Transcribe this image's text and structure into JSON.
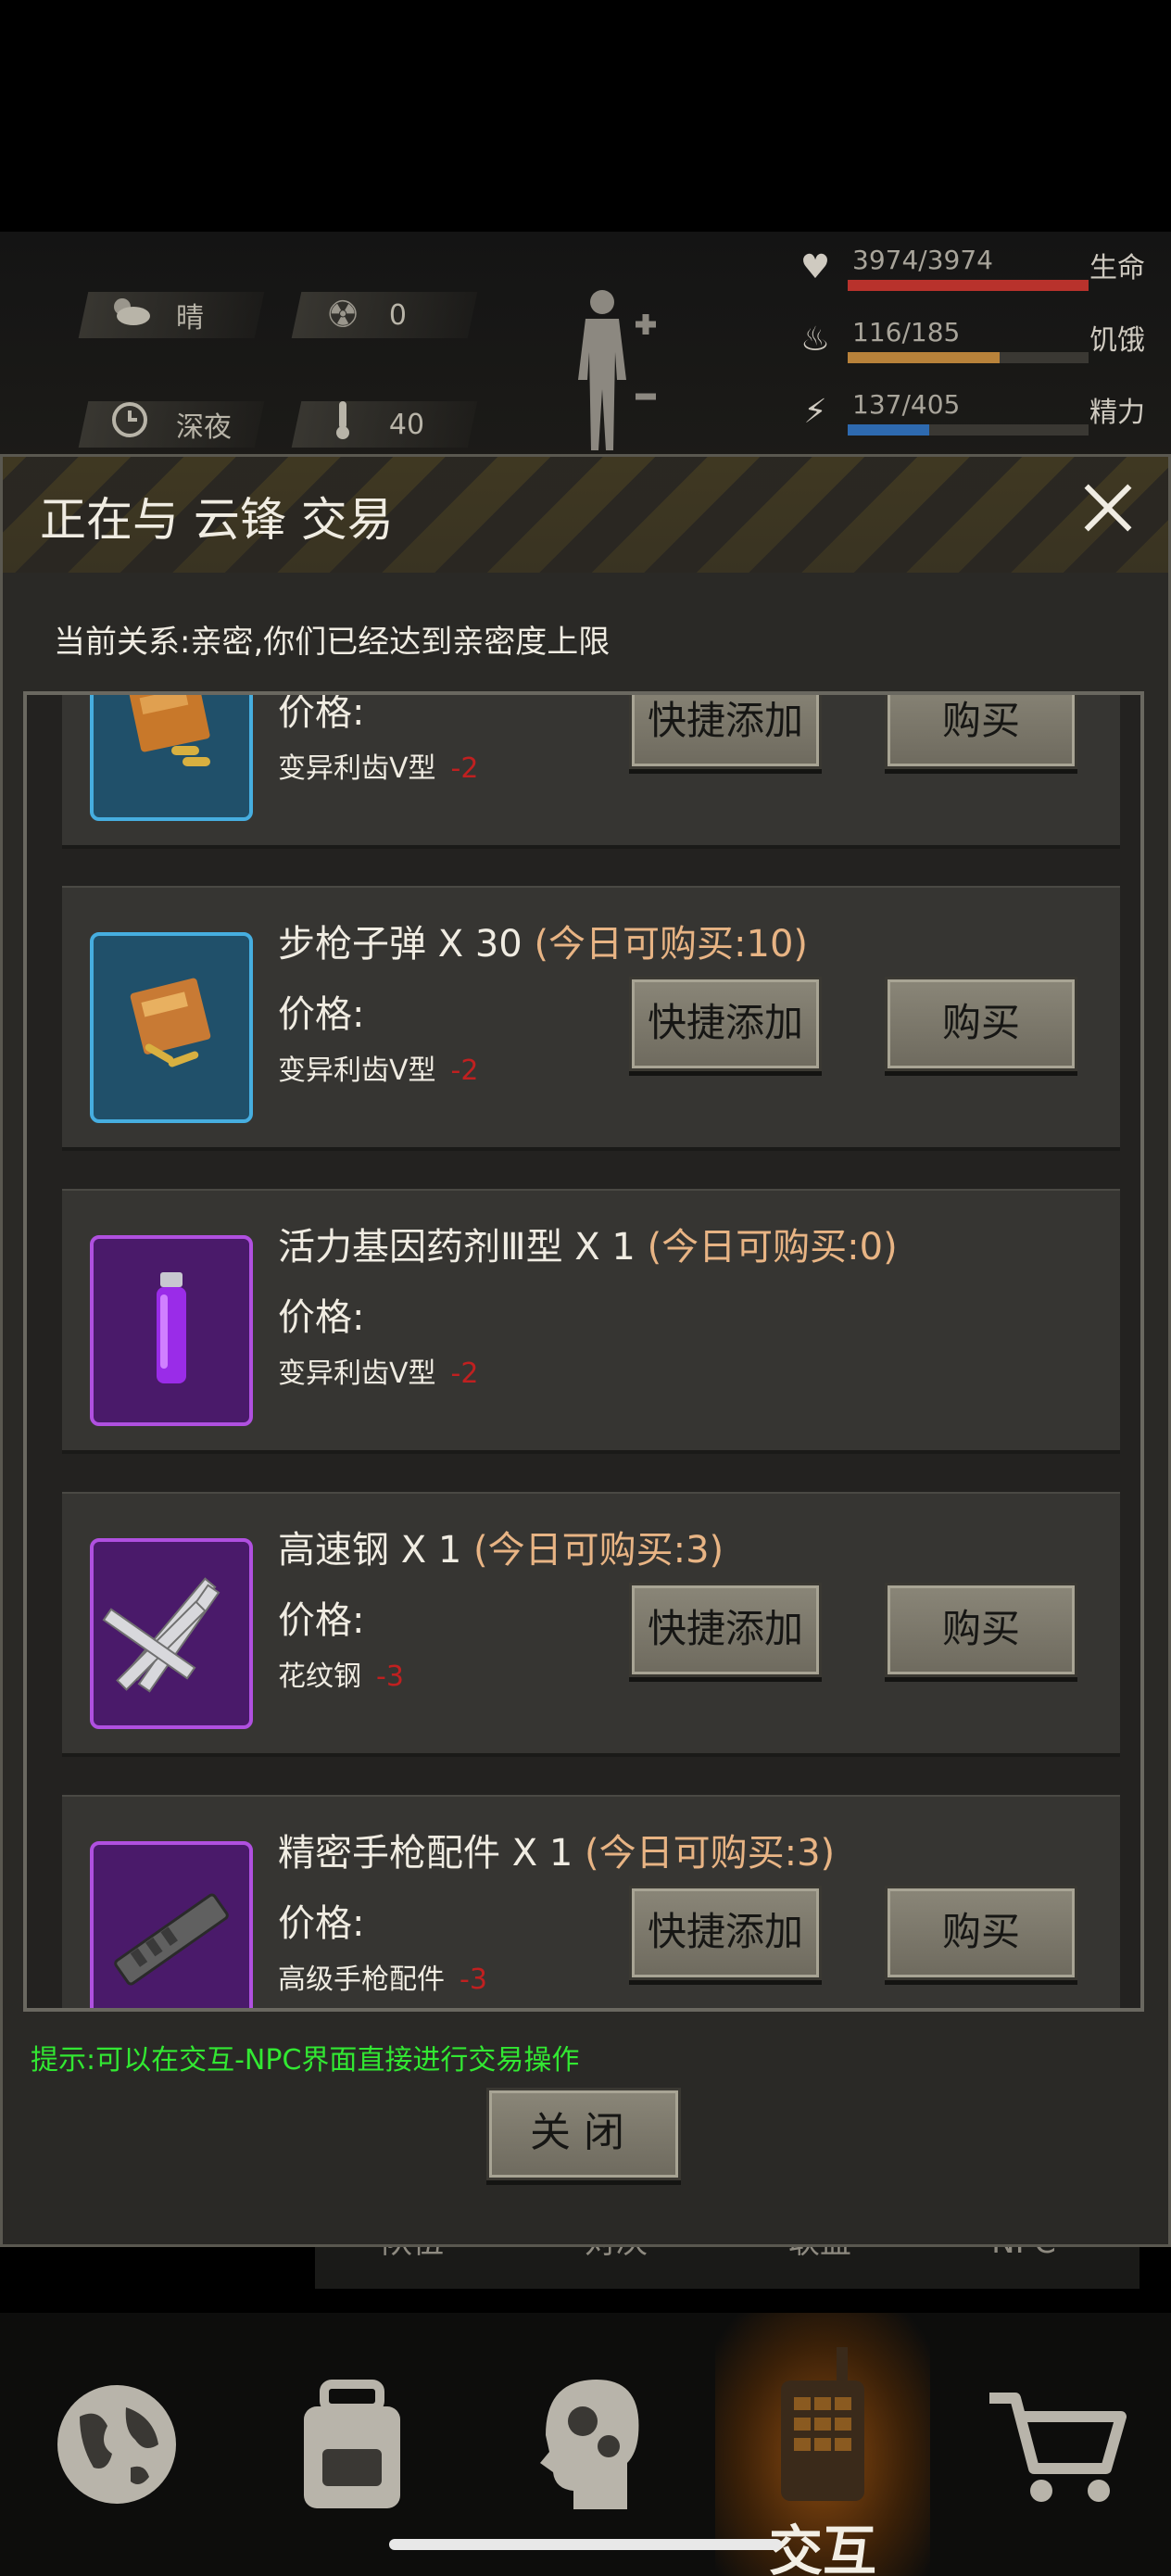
{
  "hud": {
    "weather": {
      "icon": "cloud-sun-icon",
      "label": "晴"
    },
    "radiation": {
      "icon": "radiation-icon",
      "value": "0"
    },
    "time": {
      "icon": "clock-icon",
      "label": "深夜"
    },
    "temperature": {
      "icon": "thermometer-icon",
      "value": "40"
    },
    "stats": [
      {
        "name": "生命",
        "value": "3974/3974",
        "fraction": 1.0,
        "color": "#b8322c",
        "icon": "heart-pulse-icon"
      },
      {
        "name": "饥饿",
        "value": "116/185",
        "fraction": 0.63,
        "color": "#b8823a",
        "icon": "stomach-icon"
      },
      {
        "name": "精力",
        "value": "137/405",
        "fraction": 0.34,
        "color": "#2e6ab0",
        "icon": "energy-head-icon"
      }
    ]
  },
  "modal": {
    "title": "正在与 云锋 交易",
    "relation": "当前关系:亲密,你们已经达到亲密度上限",
    "tip": "提示:可以在交互-NPC界面直接进行交易操作",
    "close_label": "关闭"
  },
  "price_label": "价格:",
  "quick_add_label": "快捷添加",
  "buy_label": "购买",
  "items": [
    {
      "title": "",
      "quota": "",
      "price_item": "变异利齿Ⅴ型",
      "cost": "-2",
      "icon": "ammo-box-icon",
      "color": "blue",
      "buttons": true
    },
    {
      "title": "步枪子弹 X 30",
      "quota": "(今日可购买:10)",
      "price_item": "变异利齿Ⅴ型",
      "cost": "-2",
      "icon": "rifle-ammo-icon",
      "color": "blue",
      "buttons": true
    },
    {
      "title": "活力基因药剂Ⅲ型 X 1",
      "quota": "(今日可购买:0)",
      "price_item": "变异利齿Ⅴ型",
      "cost": "-2",
      "icon": "vial-icon",
      "color": "purple",
      "buttons": false
    },
    {
      "title": "高速钢 X 1",
      "quota": "(今日可购买:3)",
      "price_item": "花纹钢",
      "cost": "-3",
      "icon": "steel-bars-icon",
      "color": "purple",
      "buttons": true
    },
    {
      "title": "精密手枪配件 X 1",
      "quota": "(今日可购买:3)",
      "price_item": "高级手枪配件",
      "cost": "-3",
      "icon": "pistol-parts-icon",
      "color": "purple",
      "buttons": true
    }
  ],
  "subtabs": [
    "队伍",
    "对决",
    "联盟",
    "NPC"
  ],
  "nav": [
    {
      "name": "world",
      "icon": "globe-icon",
      "label": ""
    },
    {
      "name": "backpack",
      "icon": "backpack-icon",
      "label": ""
    },
    {
      "name": "skills",
      "icon": "head-gears-icon",
      "label": ""
    },
    {
      "name": "interact",
      "icon": "walkie-talkie-icon",
      "label": "交互",
      "active": true
    },
    {
      "name": "shop",
      "icon": "cart-icon",
      "label": ""
    }
  ]
}
